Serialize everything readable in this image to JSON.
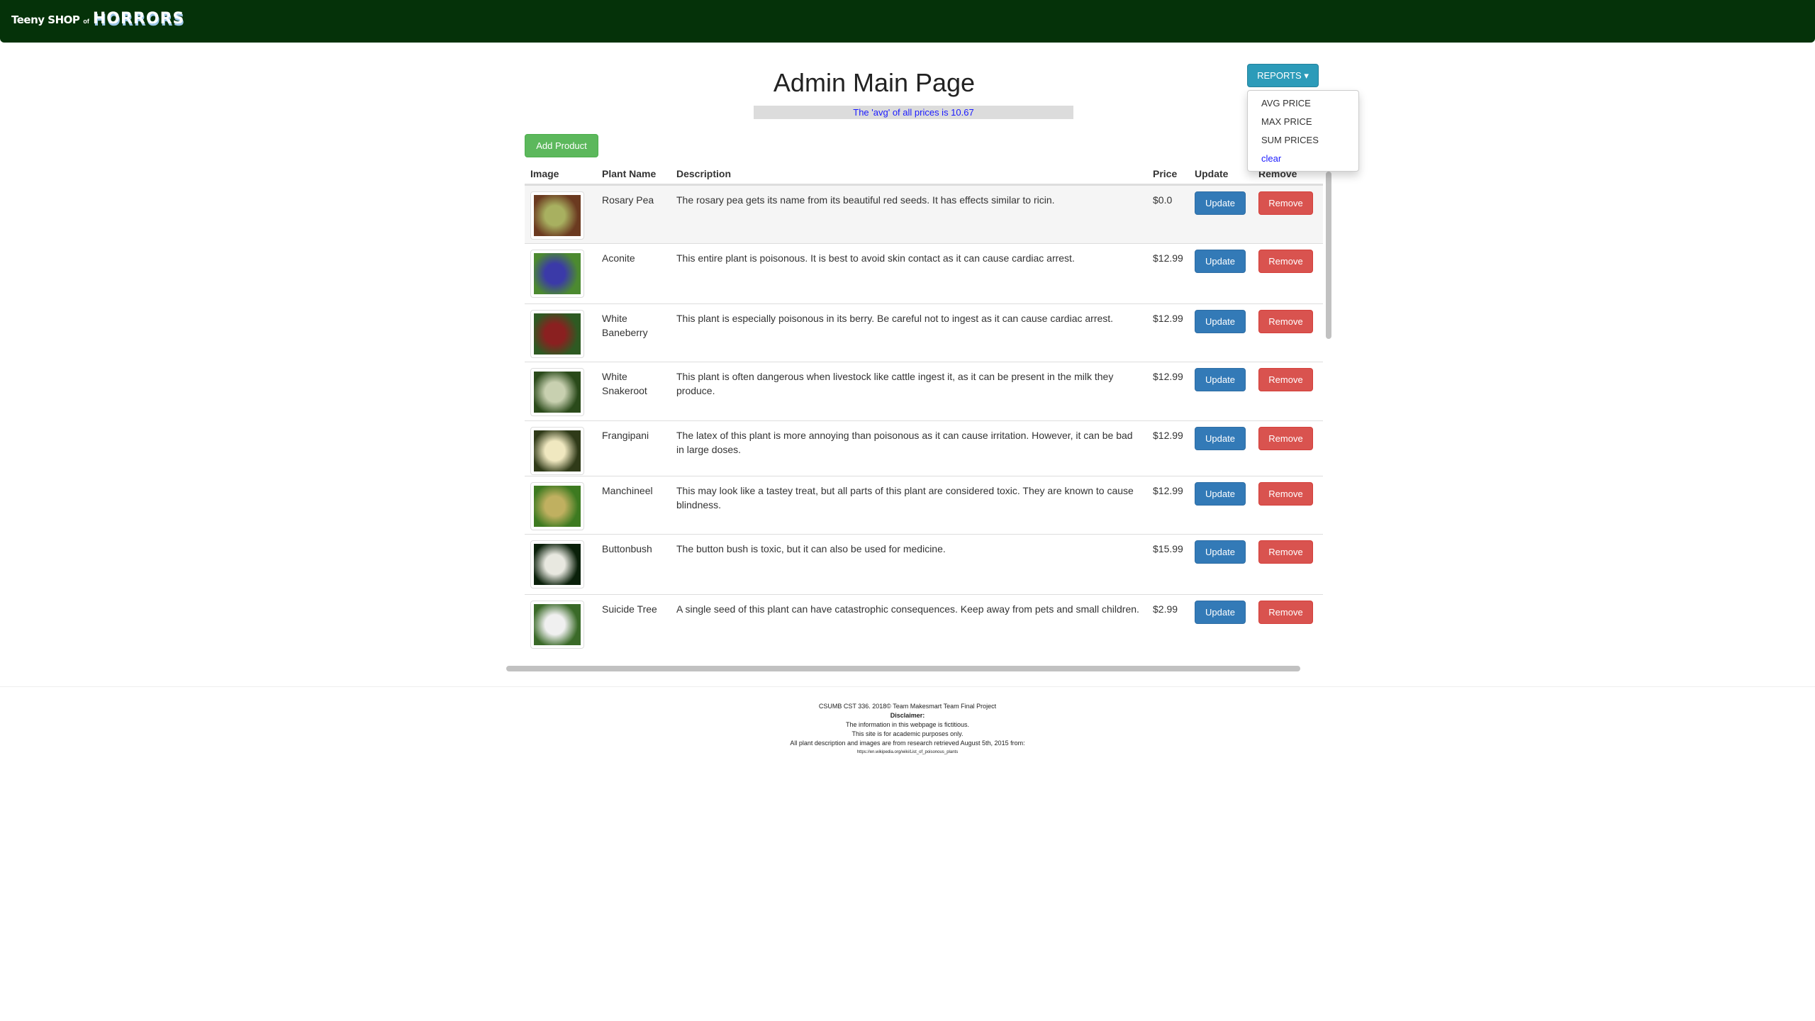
{
  "header": {
    "logo_text": "Teeny SHOP of HORRORS",
    "logo_parts": [
      "Teeny SHOP",
      "of",
      "HORRORS"
    ]
  },
  "page": {
    "title": "Admin Main Page",
    "avg_message": "The 'avg' of all prices is 10.67",
    "add_product_label": "Add Product"
  },
  "reports": {
    "label": "REPORTS ▾",
    "items": [
      "AVG PRICE",
      "MAX PRICE",
      "SUM PRICES",
      "clear"
    ]
  },
  "table": {
    "columns": [
      "Image",
      "Plant Name",
      "Description",
      "Price",
      "Update",
      "Remove"
    ],
    "update_label": "Update",
    "remove_label": "Remove",
    "rows": [
      {
        "name": "Rosary Pea",
        "description": "The rosary pea gets its name from its beautiful red seeds. It has effects similar to ricin.",
        "price": "$0.0",
        "colors": [
          "#a8b060",
          "#6b3a20"
        ]
      },
      {
        "name": "Aconite",
        "description": "This entire plant is poisonous. It is best to avoid skin contact as it can cause cardiac arrest.",
        "price": "$12.99",
        "colors": [
          "#3b3aa8",
          "#4c8a30"
        ]
      },
      {
        "name": "White Baneberry",
        "description": "This plant is especially poisonous in its berry. Be careful not to ingest as it can cause cardiac arrest.",
        "price": "$12.99",
        "colors": [
          "#8a2020",
          "#2e5a22"
        ]
      },
      {
        "name": "White Snakeroot",
        "description": "This plant is often dangerous when livestock like cattle ingest it, as it can be present in the milk they produce.",
        "price": "$12.99",
        "colors": [
          "#c8d0b0",
          "#2a4a1a"
        ]
      },
      {
        "name": "Frangipani",
        "description": "The latex of this plant is more annoying than poisonous as it can cause irritation. However, it can be bad in large doses.",
        "price": "$12.99",
        "colors": [
          "#f0e8c0",
          "#2f3a18"
        ]
      },
      {
        "name": "Manchineel",
        "description": "This may look like a tastey treat, but all parts of this plant are considered toxic. They are known to cause blindness.",
        "price": "$12.99",
        "colors": [
          "#c0b060",
          "#3d7a20"
        ]
      },
      {
        "name": "Buttonbush",
        "description": "The button bush is toxic, but it can also be used for medicine.",
        "price": "$15.99",
        "colors": [
          "#e8e8e0",
          "#0a200a"
        ]
      },
      {
        "name": "Suicide Tree",
        "description": "A single seed of this plant can have catastrophic consequences. Keep away from pets and small children.",
        "price": "$2.99",
        "colors": [
          "#f0f0f0",
          "#3a6a28"
        ]
      }
    ]
  },
  "footer": {
    "line1": "CSUMB CST 336. 2018© Team Makesmart Team Final Project",
    "disclaimer": "Disclaimer:",
    "line2": "The information in this webpage is fictitious.",
    "line3": "This site is for academic purposes only.",
    "line4": "All plant description and images are from research retrieved August 5th, 2015 from:",
    "url": "https://en.wikipedia.org/wiki/List_of_poisonous_plants"
  },
  "colors": {
    "header_bg": "#053209",
    "reports_btn": "#2c9bb9",
    "update_btn": "#337ab7",
    "remove_btn": "#d9534f",
    "add_btn": "#5cb85c"
  }
}
